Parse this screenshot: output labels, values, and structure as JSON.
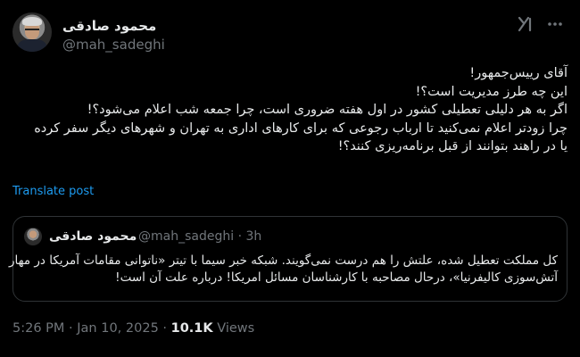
{
  "author": {
    "name": "محمود صادقی",
    "handle": "@mah_sadeghi"
  },
  "icons": {
    "grok": "grok-icon",
    "more": "more-options-icon"
  },
  "tweet": {
    "lines": [
      "آقای رییس‌جمهور!",
      "این چه طرز مدیریت است؟!",
      "اگر به هر دلیلی تعطیلی کشور در اول هفته ضروری است، چرا جمعه شب اعلام می‌شود؟!",
      "چرا زودتر اعلام نمی‌کنید تا ارباب رجوعی که برای کارهای اداری به تهران و شهرهای دیگر سفر کرده",
      "یا در راهند بتوانند از قبل برنامه‌ریزی کنند؟!"
    ],
    "translate_label": "Translate post"
  },
  "quote": {
    "name": "محمود صادقی",
    "handle": "@mah_sadeghi",
    "separator": "·",
    "age": "3h",
    "lines": [
      "کل مملکت تعطیل شده، علتش را هم درست نمی‌گویند. شبکه خبر سیما با تیتر «ناتوانی مقامات آمریکا در مهار",
      "آتش‌سوزی کالیفرنیا»، درحال مصاحبه با کارشناسان مسائل امریکا! درباره علت آن است!"
    ]
  },
  "footer": {
    "time": "5:26 PM",
    "separator": "·",
    "date": "Jan 10, 2025",
    "views_count": "10.1K",
    "views_label": "Views"
  },
  "colors": {
    "background": "#000000",
    "text": "#e7e9ea",
    "muted": "#71767b",
    "link": "#1d9bf0",
    "border": "#2f3336"
  }
}
